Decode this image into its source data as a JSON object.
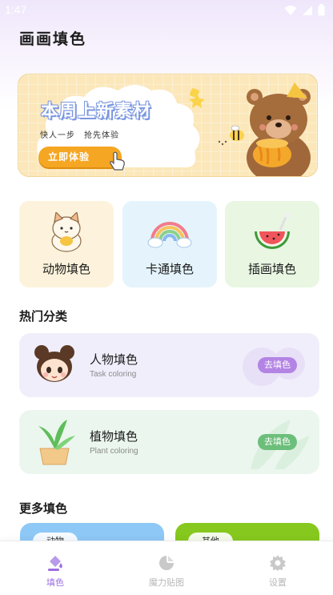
{
  "status_bar": {
    "time": "1:47"
  },
  "header": {
    "title": "画画填色"
  },
  "banner": {
    "headline": "本周上新素材",
    "subline": "快人一步　抢先体验",
    "cta_label": "立即体验"
  },
  "categories": [
    {
      "label": "动物填色",
      "icon": "cat-icon",
      "bg": "#fdf3dc"
    },
    {
      "label": "卡通填色",
      "icon": "rainbow-icon",
      "bg": "#e5f4fc"
    },
    {
      "label": "插画填色",
      "icon": "watermelon-icon",
      "bg": "#e8f6e2"
    }
  ],
  "hot_section": {
    "title": "热门分类",
    "cards": [
      {
        "title": "人物填色",
        "subtitle": "Task coloring",
        "button": "去填色",
        "bg": "#f1eefb",
        "accent": "#b384e4"
      },
      {
        "title": "植物填色",
        "subtitle": "Plant coloring",
        "button": "去填色",
        "bg": "#ebf6ee",
        "accent": "#6cbf7a"
      }
    ]
  },
  "more_section": {
    "title": "更多填色",
    "cards": [
      {
        "label": "动物",
        "bg": "#8ec8f7"
      },
      {
        "label": "其他",
        "bg": "#86c81e"
      }
    ]
  },
  "tab_bar": {
    "items": [
      {
        "label": "填色",
        "icon": "paint-bucket-icon",
        "active": true
      },
      {
        "label": "魔力贴图",
        "icon": "sticker-icon",
        "active": false
      },
      {
        "label": "设置",
        "icon": "gear-icon",
        "active": false
      }
    ],
    "active_color": "#9b6ee0",
    "inactive_color": "#b8b8b8"
  }
}
